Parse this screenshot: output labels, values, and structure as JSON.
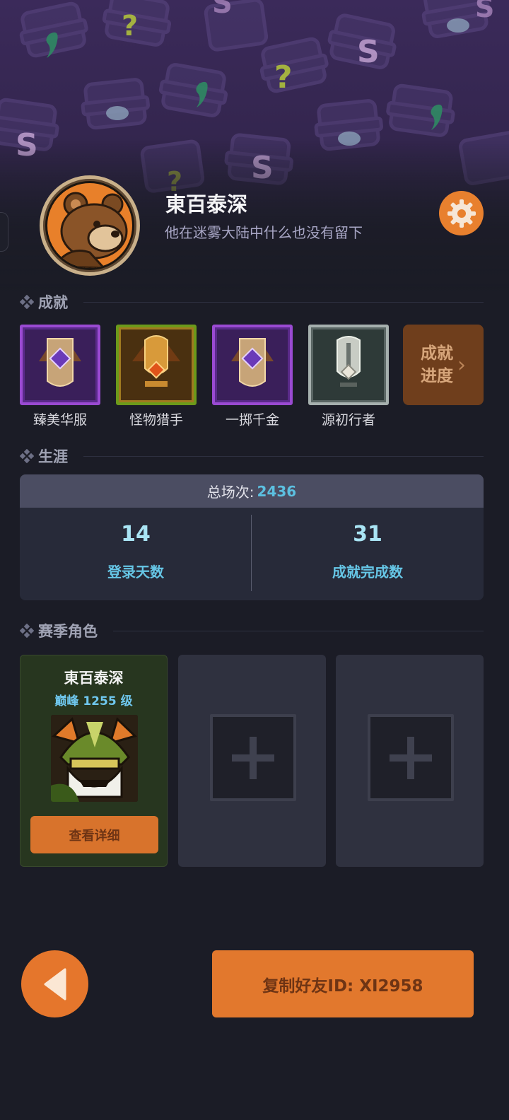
{
  "profile": {
    "name": "東百泰深",
    "bio": "他在迷雾大陆中什么也没有留下"
  },
  "sections": {
    "achievements": "成就",
    "career": "生涯",
    "season_characters": "赛季角色"
  },
  "achievements": [
    {
      "label": "臻美华服",
      "tier": "purple"
    },
    {
      "label": "怪物猎手",
      "tier": "gold"
    },
    {
      "label": "一掷千金",
      "tier": "purple"
    },
    {
      "label": "源初行者",
      "tier": "silver"
    }
  ],
  "achievement_progress": {
    "line1": "成就",
    "line2": "进度",
    "chevron": "›"
  },
  "career": {
    "total_label": "总场次:",
    "total_value": "2436",
    "login_days_value": "14",
    "login_days_label": "登录天数",
    "achievements_done_value": "31",
    "achievements_done_label": "成就完成数"
  },
  "season_slots": [
    {
      "name": "東百泰深",
      "level": "巅峰 1255 级",
      "button": "查看详细"
    }
  ],
  "bottom": {
    "copy_id_label": "复制好友ID: XI2958"
  },
  "colors": {
    "accent_orange": "#e2782d",
    "cyan": "#5cc0e0",
    "panel": "#272a39"
  }
}
